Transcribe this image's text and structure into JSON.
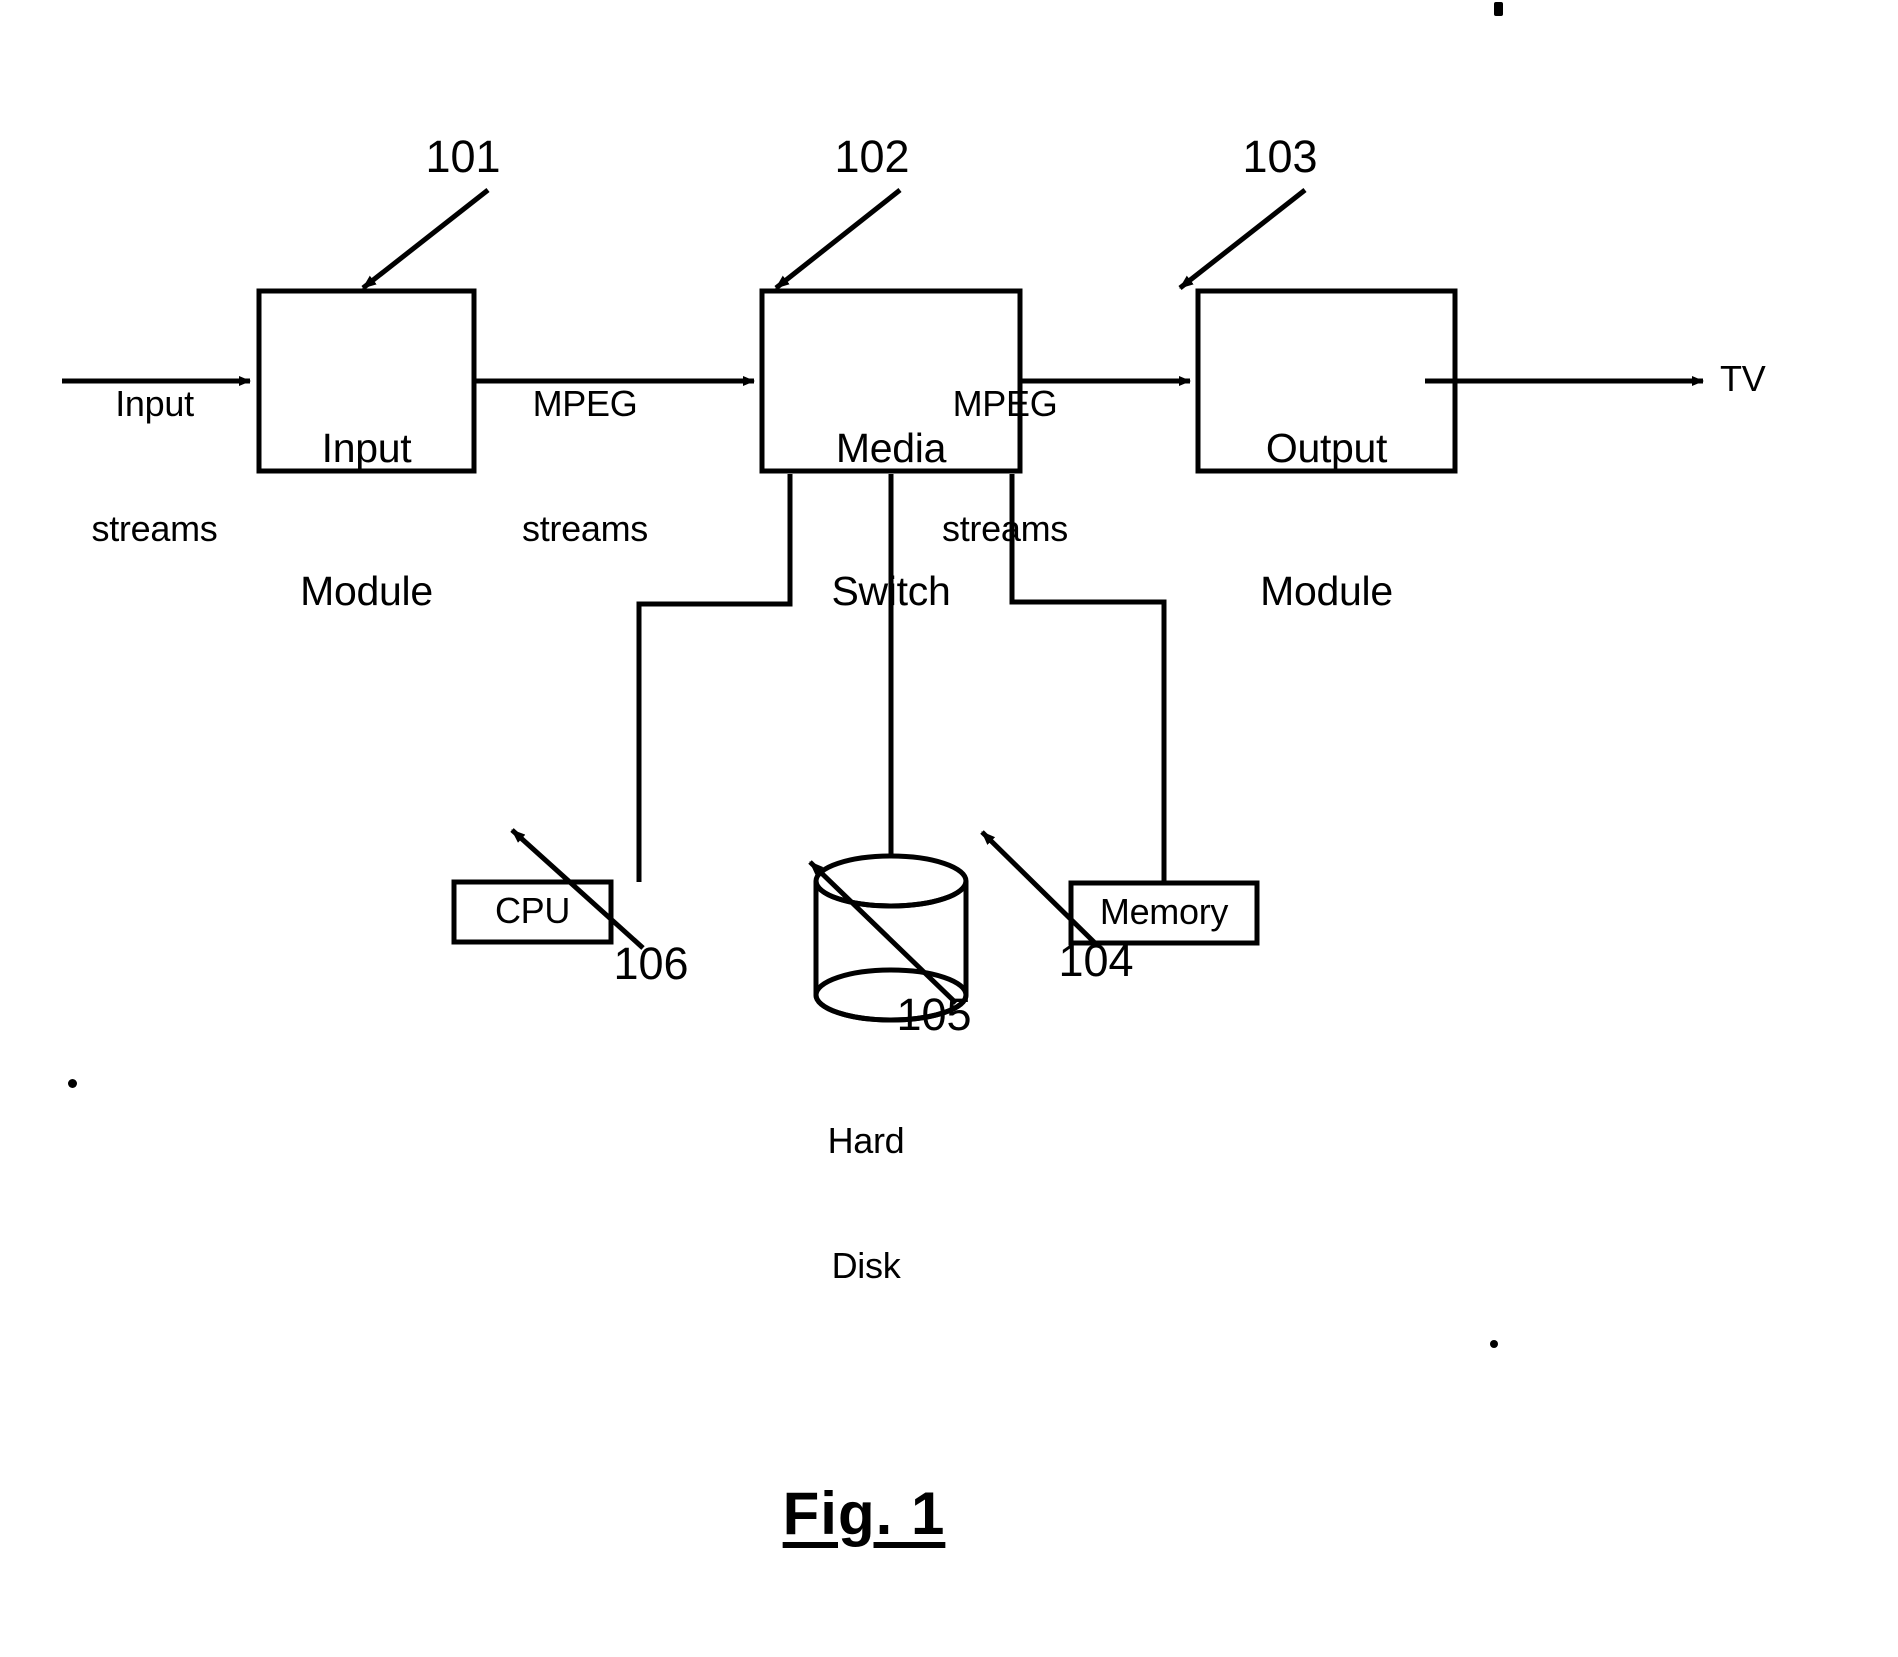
{
  "figure": {
    "caption": "Fig. 1",
    "blocks": [
      {
        "id": "input-module",
        "label": "Input\nModule",
        "ref": "101"
      },
      {
        "id": "media-switch",
        "label": "Media\nSwitch",
        "ref": "102"
      },
      {
        "id": "output-module",
        "label": "Output\nModule",
        "ref": "103"
      },
      {
        "id": "cpu",
        "label": "CPU",
        "ref": "106"
      },
      {
        "id": "hard-disk",
        "label": "Hard\nDisk",
        "ref": "105"
      },
      {
        "id": "memory",
        "label": "Memory",
        "ref": "104"
      }
    ],
    "edge_labels": {
      "input_streams": "Input\nstreams",
      "mpeg_streams_1": "MPEG\nstreams",
      "mpeg_streams_2": "MPEG\nstreams",
      "tv": "TV"
    },
    "reference_numerals": {
      "input_module": "101",
      "media_switch": "102",
      "output_module": "103",
      "memory": "104",
      "hard_disk": "105",
      "cpu": "106"
    },
    "block_labels": {
      "input_module_line1": "Input",
      "input_module_line2": "Module",
      "media_switch_line1": "Media",
      "media_switch_line2": "Switch",
      "output_module_line1": "Output",
      "output_module_line2": "Module",
      "cpu": "CPU",
      "memory": "Memory",
      "hard_disk_line1": "Hard",
      "hard_disk_line2": "Disk"
    },
    "edge_label_lines": {
      "input_streams_line1": "Input",
      "input_streams_line2": "streams",
      "mpeg1_line1": "MPEG",
      "mpeg1_line2": "streams",
      "mpeg2_line1": "MPEG",
      "mpeg2_line2": "streams",
      "tv": "TV"
    },
    "colors": {
      "stroke": "#000000",
      "background": "#ffffff"
    }
  }
}
